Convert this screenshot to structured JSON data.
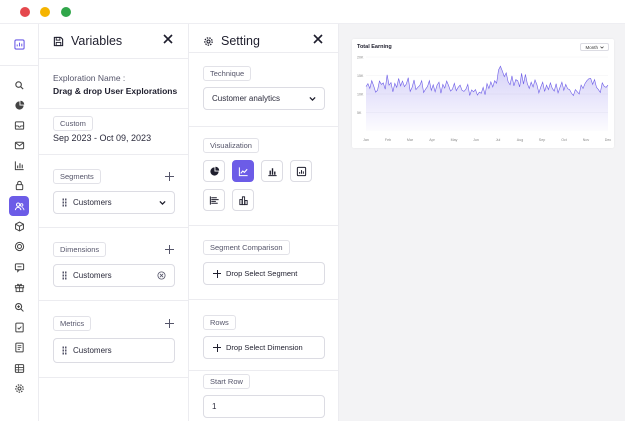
{
  "window": {
    "dots": [
      "#e5484d",
      "#f5b400",
      "#30a64a"
    ]
  },
  "rail": {
    "accent": "#6c5ce7",
    "icons": [
      "dashboard-icon",
      "search-icon",
      "pie-icon",
      "inbox-icon",
      "mail-icon",
      "bar-chart-icon",
      "lock-icon",
      "users-icon",
      "box-icon",
      "target-icon",
      "message-icon",
      "gift-icon",
      "zoom-icon",
      "document-check-icon",
      "file-icon",
      "table-icon",
      "gear-icon"
    ],
    "active_index": 7
  },
  "variables": {
    "title": "Variables",
    "exploration_label": "Exploration Name :",
    "exploration_name": "Drag & drop User Explorations",
    "range_chip": "Custom",
    "date_range": "Sep 2023 - Oct 09, 2023",
    "segments": {
      "label": "Segments",
      "item": "Customers"
    },
    "dimensions": {
      "label": "Dimensions",
      "item": "Customers"
    },
    "metrics": {
      "label": "Metrics",
      "item": "Customers"
    }
  },
  "setting": {
    "title": "Setting",
    "technique_label": "Technique",
    "technique_value": "Customer analytics",
    "visualization_label": "Visualization",
    "viz_icons": [
      "pie-chart-icon",
      "line-chart-icon",
      "bar-chart-icon",
      "image-chart-icon",
      "horizontal-bar-icon",
      "column-chart-icon"
    ],
    "viz_active": 1,
    "segment_comparison_label": "Segment Comparison",
    "drop_segment": "Drop Select Segment",
    "rows_label": "Rows",
    "drop_dimension": "Drop Select Dimension",
    "start_row_label": "Start Row",
    "start_row_value": "1"
  },
  "chart_data": {
    "type": "area",
    "title": "Total Earning",
    "period": "Month",
    "x_ticks": [
      "Jan",
      "Feb",
      "Mar",
      "Apr",
      "May",
      "Jun",
      "Jul",
      "Aug",
      "Sep",
      "Oct",
      "Nov",
      "Dec"
    ],
    "y_ticks": [
      "20K",
      "15K",
      "10K",
      "5K"
    ],
    "ylim": [
      0,
      20000
    ],
    "color": "#6c5ce7",
    "values": [
      12000,
      12800,
      11500,
      13600,
      12200,
      10500,
      11000,
      13500,
      12600,
      13000,
      11300,
      15200,
      12400,
      13100,
      10600,
      12900,
      11800,
      14200,
      12200,
      13500,
      12000,
      12700,
      14400,
      10700,
      11800,
      13800,
      11200,
      11800,
      12300,
      13600,
      10400,
      11300,
      12000,
      13600,
      11000,
      12500,
      10600,
      12400,
      13200,
      10200,
      12600,
      11600,
      13500,
      12300,
      10800,
      11300,
      12900,
      10900,
      11800,
      12400,
      11000,
      10700,
      11300,
      12600,
      9600,
      11100,
      10600,
      11200,
      9700,
      10500,
      10200,
      11800,
      9800,
      12800,
      11500,
      13300,
      11900,
      13600,
      12900,
      16500,
      17500,
      16200,
      14700,
      15700,
      13300,
      12500,
      14900,
      12200,
      13900,
      13600,
      11900,
      15600,
      12700,
      15300,
      12800,
      11500,
      13200,
      11900,
      13800,
      12500,
      10300,
      11900,
      13200,
      10700,
      12400,
      11200,
      13000,
      11500,
      10800,
      12800,
      10300,
      11800,
      13200,
      11000,
      12600,
      11400,
      11200,
      10200,
      9600,
      11200,
      10600,
      10000,
      12400,
      11500,
      12800,
      13600,
      14100,
      14200,
      12600,
      13900,
      11800,
      11200,
      10400,
      13000,
      12100,
      11800,
      12400
    ]
  }
}
